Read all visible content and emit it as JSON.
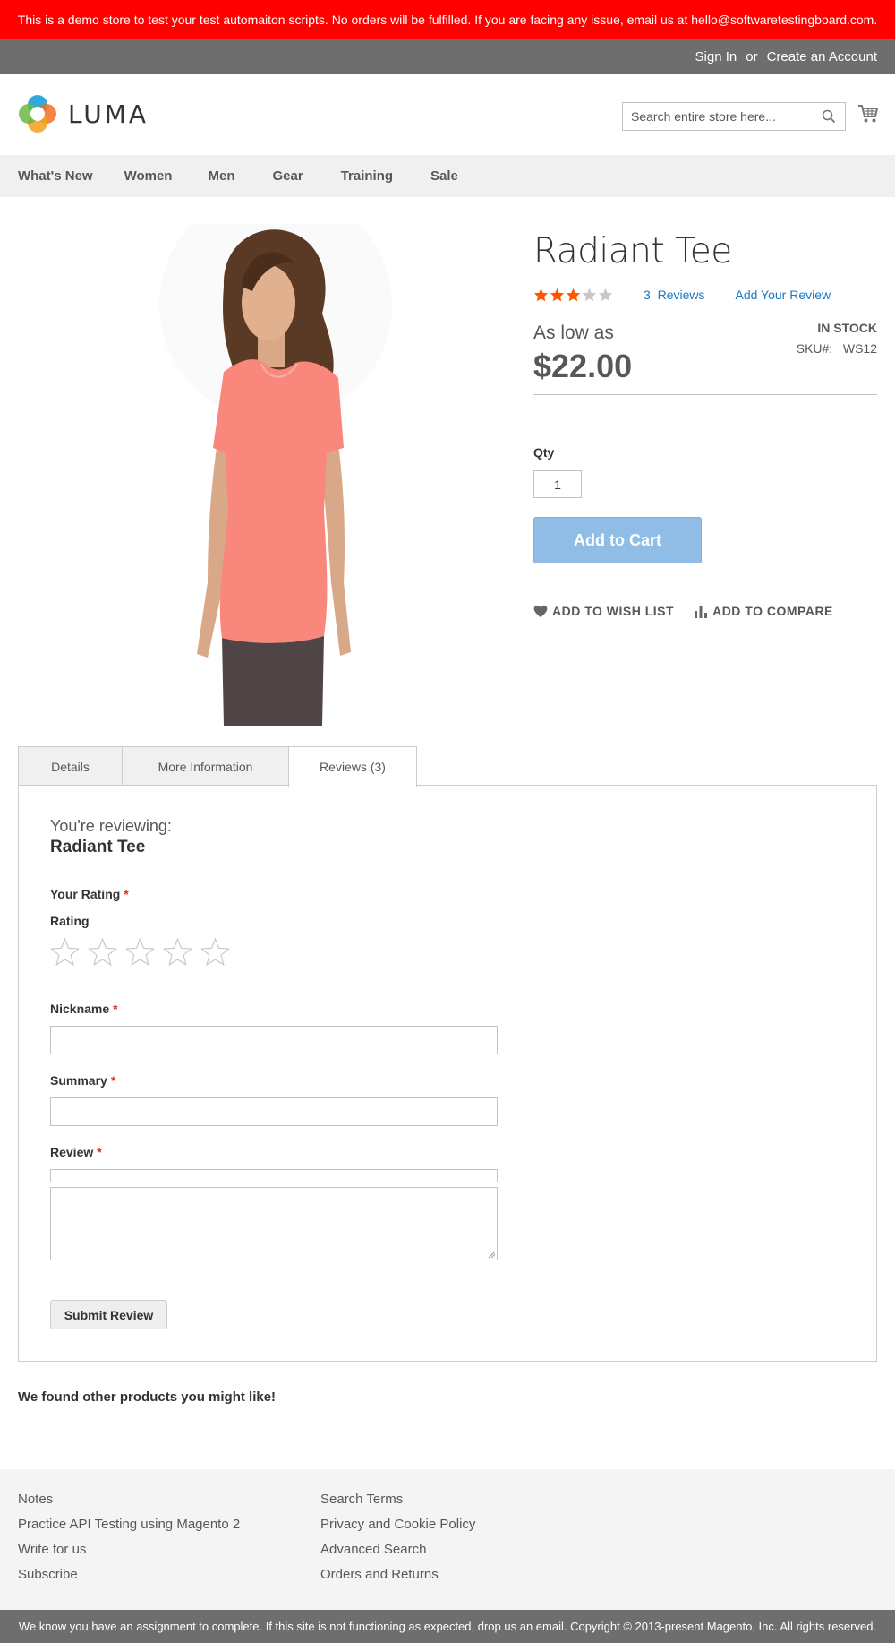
{
  "banner": {
    "text": "This is a demo store to test your test automaiton scripts. No orders will be fulfilled. If you are facing any issue, email us at hello@softwaretestingboard.com."
  },
  "header_panel": {
    "sign_in": "Sign In",
    "or": "or",
    "create_account": "Create an Account"
  },
  "logo": {
    "text": "LUMA"
  },
  "search": {
    "placeholder": "Search entire store here..."
  },
  "nav": {
    "items": [
      {
        "label": "What's New"
      },
      {
        "label": "Women"
      },
      {
        "label": "Men"
      },
      {
        "label": "Gear"
      },
      {
        "label": "Training"
      },
      {
        "label": "Sale"
      }
    ]
  },
  "product": {
    "title": "Radiant Tee",
    "rating_fraction": 0.6,
    "reviews_count": "3",
    "reviews_label": "Reviews",
    "add_review": "Add Your Review",
    "price_label": "As low as",
    "price": "$22.00",
    "stock": "IN STOCK",
    "sku_label": "SKU#:",
    "sku": "WS12",
    "qty_label": "Qty",
    "qty_value": "1",
    "add_to_cart": "Add to Cart",
    "add_to_wishlist": "ADD TO WISH LIST",
    "add_to_compare": "ADD TO COMPARE"
  },
  "tabs": [
    {
      "label": "Details"
    },
    {
      "label": "More Information"
    },
    {
      "label": "Reviews (3)"
    }
  ],
  "review_form": {
    "reviewing_label": "You're reviewing:",
    "product_name": "Radiant Tee",
    "your_rating_label": "Your Rating",
    "rating_label": "Rating",
    "required_mark": "*",
    "nickname_label": "Nickname",
    "summary_label": "Summary",
    "review_label": "Review",
    "submit": "Submit Review"
  },
  "related": {
    "heading": "We found other products you might like!"
  },
  "footer": {
    "col1": [
      "Notes",
      "Practice API Testing using Magento 2",
      "Write for us",
      "Subscribe"
    ],
    "col2": [
      "Search Terms",
      "Privacy and Cookie Policy",
      "Advanced Search",
      "Orders and Returns"
    ]
  },
  "copyright": {
    "text": "We know you have an assignment to complete. If this site is not functioning as expected, drop us an email. Copyright © 2013-present Magento, Inc. All rights reserved."
  },
  "colors": {
    "banner_bg": "#ff0000",
    "header_panel_bg": "#6e6e6e",
    "link_blue": "#1979c3",
    "star_filled": "#ff5501",
    "star_empty": "#c7c7c7",
    "add_to_cart_bg": "#90bde5",
    "required": "#e02b27",
    "shirt": "#f9877c"
  }
}
